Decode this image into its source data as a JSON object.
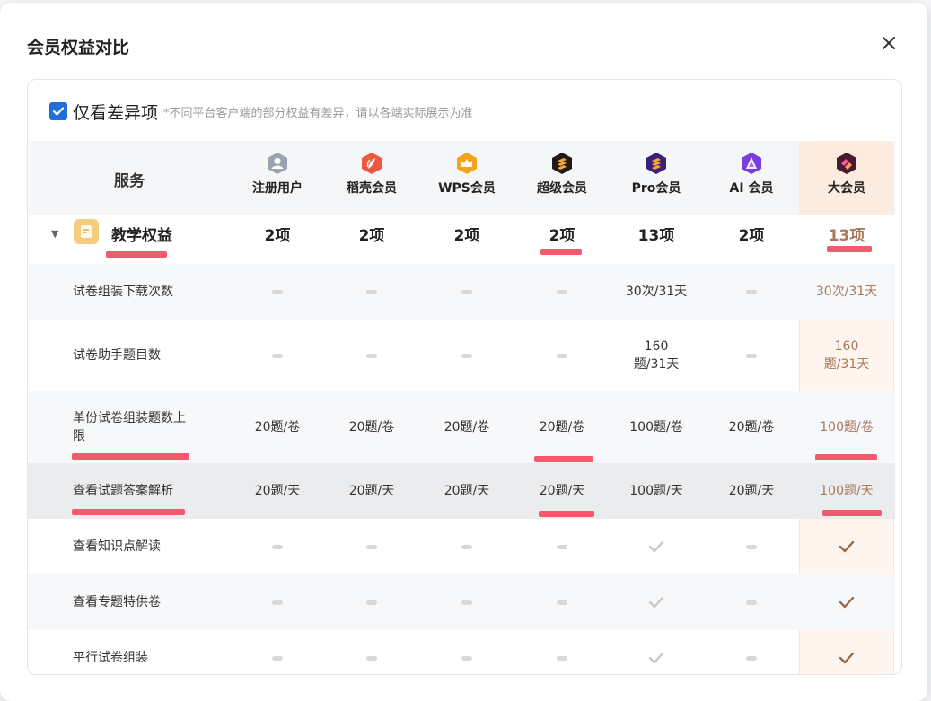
{
  "modal": {
    "title": "会员权益对比",
    "close_icon": "close-icon"
  },
  "filter": {
    "checked": true,
    "label": "仅看差异项",
    "note": "*不同平台客户端的部分权益有差异，请以各端实际展示为准"
  },
  "table": {
    "service_header": "服务",
    "tiers": [
      {
        "name": "注册用户",
        "icon": "user-icon",
        "color": "#9aa3b0"
      },
      {
        "name": "稻壳会员",
        "icon": "docer-icon",
        "color": "#f0573f"
      },
      {
        "name": "WPS会员",
        "icon": "wps-crown-icon",
        "color": "#f5a31c"
      },
      {
        "name": "超级会员",
        "icon": "super-member-icon",
        "color": "#1f1a16"
      },
      {
        "name": "Pro会员",
        "icon": "pro-member-icon",
        "color": "#3b1f7a"
      },
      {
        "name": "AI 会员",
        "icon": "ai-member-icon",
        "color": "#7a3ee0"
      },
      {
        "name": "大会员",
        "icon": "big-member-icon",
        "color": "#4a1a35"
      }
    ],
    "group": {
      "title": "教学权益",
      "icon": "lesson-book-icon",
      "counts": [
        "2项",
        "2项",
        "2项",
        "2项",
        "13项",
        "2项",
        "13项"
      ]
    },
    "rows": [
      {
        "label": "试卷组装下载次数",
        "cells": [
          "dash",
          "dash",
          "dash",
          "dash",
          "30次/31天",
          "dash",
          "30次/31天"
        ]
      },
      {
        "label": "试卷助手题目数",
        "cells": [
          "dash",
          "dash",
          "dash",
          "dash",
          "160题/31天",
          "dash",
          "160题/31天"
        ]
      },
      {
        "label": "单份试卷组装题数上限",
        "cells": [
          "20题/卷",
          "20题/卷",
          "20题/卷",
          "20题/卷",
          "100题/卷",
          "20题/卷",
          "100题/卷"
        ]
      },
      {
        "label": "查看试题答案解析",
        "cells": [
          "20题/天",
          "20题/天",
          "20题/天",
          "20题/天",
          "100题/天",
          "20题/天",
          "100题/天"
        ]
      },
      {
        "label": "查看知识点解读",
        "cells": [
          "dash",
          "dash",
          "dash",
          "dash",
          "check",
          "dash",
          "check"
        ]
      },
      {
        "label": "查看专题特供卷",
        "cells": [
          "dash",
          "dash",
          "dash",
          "dash",
          "check",
          "dash",
          "check"
        ]
      },
      {
        "label": "平行试卷组装",
        "cells": [
          "dash",
          "dash",
          "dash",
          "dash",
          "check",
          "dash",
          "check"
        ]
      }
    ]
  },
  "colors": {
    "accent_blue": "#1f6fd8",
    "highlight_text": "#a9785a",
    "highlight_bg": "#fdf5ee",
    "annotation_red": "#f25a6e"
  }
}
